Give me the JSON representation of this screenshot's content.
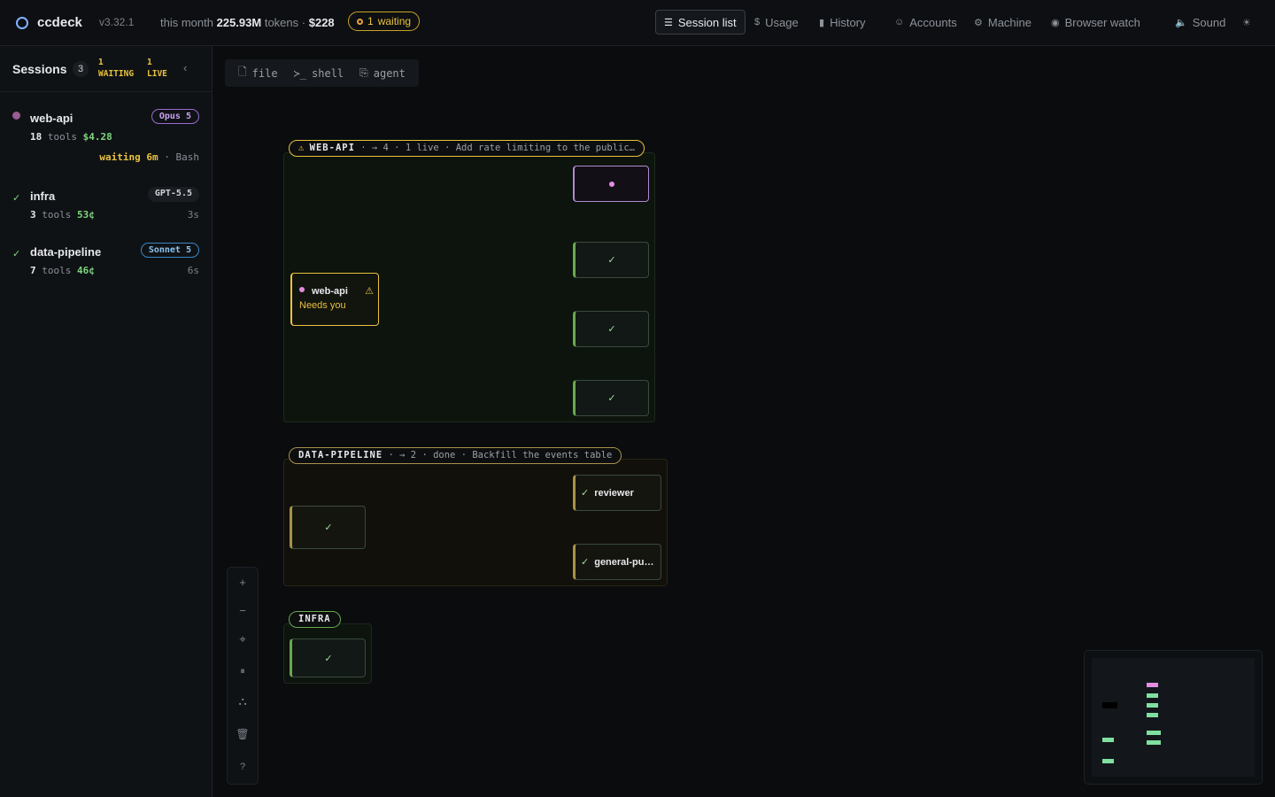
{
  "app": {
    "name": "ccdeck",
    "version": "v3.32.1"
  },
  "usage": {
    "prefix": "this month",
    "tokens": "225.93M",
    "tokens_label": "tokens",
    "sep": "·",
    "cost": "$228"
  },
  "waiting_pill": {
    "count": "1",
    "label": "waiting"
  },
  "nav": [
    {
      "icon": "☰",
      "label": "Session list",
      "active": true
    },
    {
      "icon": "$",
      "label": "Usage"
    },
    {
      "icon": "▮",
      "label": "History"
    },
    {
      "icon": "☺",
      "label": "Accounts"
    },
    {
      "icon": "⚙",
      "label": "Machine"
    },
    {
      "icon": "◉",
      "label": "Browser watch"
    },
    {
      "icon": "🔈",
      "label": "Sound"
    },
    {
      "icon": "☀",
      "label": ""
    }
  ],
  "sidebar": {
    "title": "Sessions",
    "count": "3",
    "waiting": {
      "n": "1",
      "label": "WAITING"
    },
    "live": {
      "n": "1",
      "label": "LIVE"
    },
    "collapse_icon": "‹",
    "sessions": [
      {
        "name": "web-api",
        "model": "Opus 5",
        "tools": "18",
        "tools_label": "tools",
        "cost": "$4.28",
        "wait": "waiting 6m",
        "wait_sep": "·",
        "wait_tool": "Bash",
        "age": ""
      },
      {
        "name": "infra",
        "model": "GPT-5.5",
        "tools": "3",
        "tools_label": "tools",
        "cost": "53¢",
        "age": "3s"
      },
      {
        "name": "data-pipeline",
        "model": "Sonnet 5",
        "tools": "7",
        "tools_label": "tools",
        "cost": "46¢",
        "age": "6s"
      }
    ]
  },
  "tool_tabs": [
    {
      "icon": "🗋",
      "label": "file"
    },
    {
      "icon": "≻_",
      "label": "shell"
    },
    {
      "icon": "⎘",
      "label": "agent"
    }
  ],
  "groups": {
    "web_api": {
      "warn": "⚠",
      "name": "WEB-API",
      "info": "· → 4 · 1 live · Add rate limiting to the public…",
      "main_node": {
        "name": "web-api",
        "status": "Needs you",
        "warn": "⚠"
      }
    },
    "data_pipeline": {
      "name": "DATA-PIPELINE",
      "info": "· → 2 · done · Backfill the events table",
      "children": [
        "reviewer",
        "general-pu…"
      ]
    },
    "infra": {
      "name": "INFRA"
    }
  },
  "check": "✓",
  "controls": [
    "+",
    "−",
    "⌖",
    "⏸",
    "⛬",
    "🗑",
    "?"
  ],
  "colors": {
    "accent_green": "#6aa84f",
    "waiting_yellow": "#e8c23f",
    "live_pink": "#e48de0",
    "mint": "#7fe0a0"
  }
}
